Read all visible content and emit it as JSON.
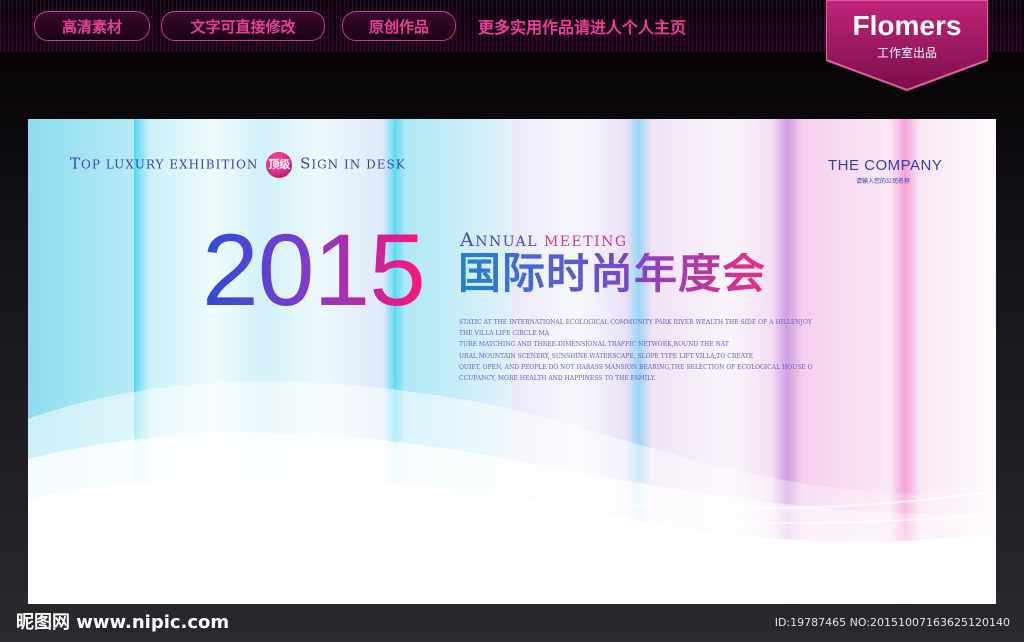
{
  "topbar": {
    "buttons": [
      "高清素材",
      "文字可直接修改",
      "原创作品"
    ],
    "note": "更多实用作品请进人个人主页",
    "brand": {
      "name": "Flomers",
      "sub": "工作室出品"
    }
  },
  "poster": {
    "tagline": {
      "w1_cap": "T",
      "w1_rest": "OP",
      "w2": "LUXURY",
      "w3": "EXHIBITION",
      "badge": "顶级",
      "w4_cap": "S",
      "w4_rest": "IGN",
      "w5": "IN",
      "w6": "DESK"
    },
    "company": "THE COMPANY",
    "company_sub": "请输入您的公司名称",
    "year": "2015",
    "annual": {
      "cap": "A",
      "rest": "NNUAL",
      "meeting": "MEETING"
    },
    "cn_title": "国际时尚年度会",
    "paragraph": "STATIC AT THE INTERNATIONAL ECOLOGICAL COMMUNITY PARK RIVER WEALTH THE SIDE OF A HILLENJOY\nTHE VILLA LIFE CIRCLE MA\nTURE MATCHING AND THREE-DIMENSIONAL TRAFFIC NETWORK,ROUND THE NAT\nURAL MOUNTAIN SCENERY, SUNSHINE WATERSCAPE, SLOPE TYPE LIFT VILLA,TO CREATE\nQUIET, OPEN, AND PEOPLE DO NOT HARASS MANSION BEARING,THE SELECTION OF ECOLOGICAL HOUSE O\nCCUPANCY, MORE HEALTH AND HAPPINESS TO THE FAMILY."
  },
  "footer": {
    "left": "昵图网 www.nipic.com",
    "right": "ID:19787465 NO:20151007163625120140"
  }
}
